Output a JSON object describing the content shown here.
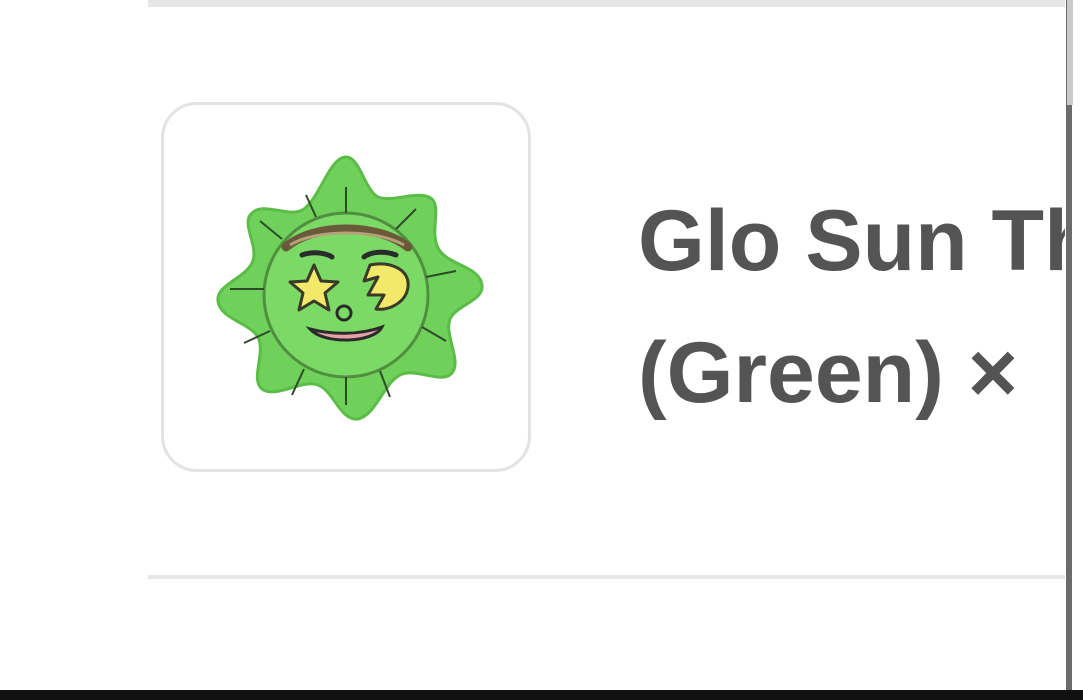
{
  "cart": {
    "item": {
      "title_line1": "Glo Sun Th",
      "title_line2": "(Green) ×",
      "image_icon": "green-sun-plush-image"
    }
  },
  "colors": {
    "title_text": "#545454",
    "divider": "#e6e6e6",
    "thumb_border": "#e3e3e3",
    "plush_green": "#6fd15a"
  }
}
